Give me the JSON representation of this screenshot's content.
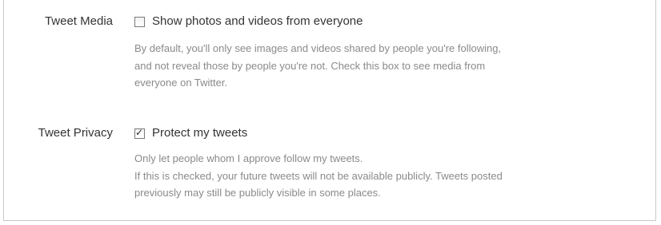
{
  "settings": {
    "media": {
      "label": "Tweet Media",
      "checkbox_label": "Show photos and videos from everyone",
      "checked": false,
      "description_lines": [
        "By default, you'll only see images and videos shared by people you're following,",
        "and not reveal those by people you're not. Check this box to see media from",
        "everyone on Twitter."
      ]
    },
    "privacy": {
      "label": "Tweet Privacy",
      "checkbox_label": "Protect my tweets",
      "checked": true,
      "check_glyph": "✓",
      "description_lines": [
        "Only let people whom I approve follow my tweets.",
        "If this is checked, your future tweets will not be available publicly. Tweets posted",
        "previously may still be publicly visible in some places."
      ]
    }
  }
}
